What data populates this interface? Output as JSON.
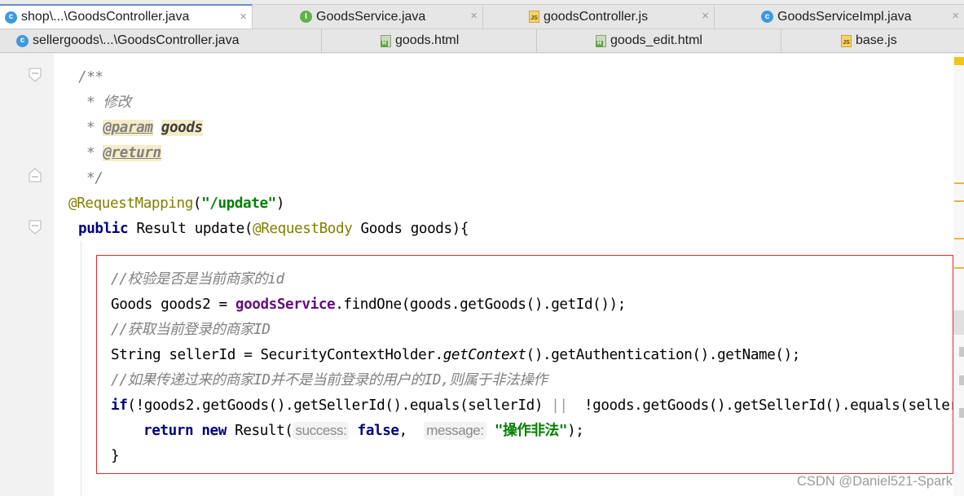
{
  "tabs_row1": [
    {
      "label": "shop\\...\\GoodsController.java",
      "icon": "class-icon",
      "badge": "c",
      "active": true,
      "closable": true
    },
    {
      "label": "GoodsService.java",
      "icon": "interface-icon",
      "badge": "I",
      "active": false,
      "closable": true
    },
    {
      "label": "goodsController.js",
      "icon": "javascript-file-icon",
      "badge": "JS",
      "active": false,
      "closable": true
    },
    {
      "label": "GoodsServiceImpl.java",
      "icon": "class-icon",
      "badge": "c",
      "active": false,
      "closable": true
    }
  ],
  "tabs_row2": [
    {
      "label": "sellergoods\\...\\GoodsController.java",
      "icon": "class-icon",
      "badge": "c"
    },
    {
      "label": "goods.html",
      "icon": "html-file-icon",
      "badge": ""
    },
    {
      "label": "goods_edit.html",
      "icon": "html-file-icon",
      "badge": ""
    },
    {
      "label": "base.js",
      "icon": "javascript-file-icon",
      "badge": "JS"
    }
  ],
  "close_glyph": "×",
  "code": {
    "doc_open": "/**",
    "doc_star": "*",
    "doc_desc": "修改",
    "doc_param_tag": "@param",
    "doc_param_name": "goods",
    "doc_return_tag": "@return",
    "doc_close": "*/",
    "mapping_annotation": "@RequestMapping",
    "mapping_open": "(",
    "mapping_path": "\"/update\"",
    "mapping_close": ")",
    "sig_kw": "public",
    "sig_mid": " Result update(",
    "sig_ann": "@RequestBody",
    "sig_rest": " Goods goods){",
    "comment1": "//校验是否是当前商家的id",
    "l2_a": "Goods goods2 = ",
    "l2_field": "goodsService",
    "l2_b": ".findOne(goods.getGoods().getId());",
    "comment2": "//获取当前登录的商家ID",
    "l4_a": "String sellerId = SecurityContextHolder.",
    "l4_static": "getContext",
    "l4_b": "().getAuthentication().getName();",
    "comment3": "//如果传递过来的商家ID并不是当前登录的用户的ID,则属于非法操作",
    "if_kw": "if",
    "if_cond": "(!goods2.getGoods().getSellerId().equals(sellerId) ",
    "if_or": "||",
    "if_cond2": "  !goods.getGoods().getSellerId().equals(sellerId",
    "ret_kw": "return",
    "new_kw": "new",
    "ret_class": " Result(",
    "hint_success": "success:",
    "false_kw": "false",
    "comma": ",",
    "hint_message": "message:",
    "ret_msg": "\"操作非法\"",
    "ret_end": ");",
    "close_brace": "}"
  },
  "watermark": "CSDN @Daniel521-Spark",
  "colors": {
    "keyword": "#000080",
    "string": "#008000",
    "annotation": "#808000",
    "comment": "#808080",
    "field": "#660e7a",
    "highlight_border": "#e02a2a"
  }
}
